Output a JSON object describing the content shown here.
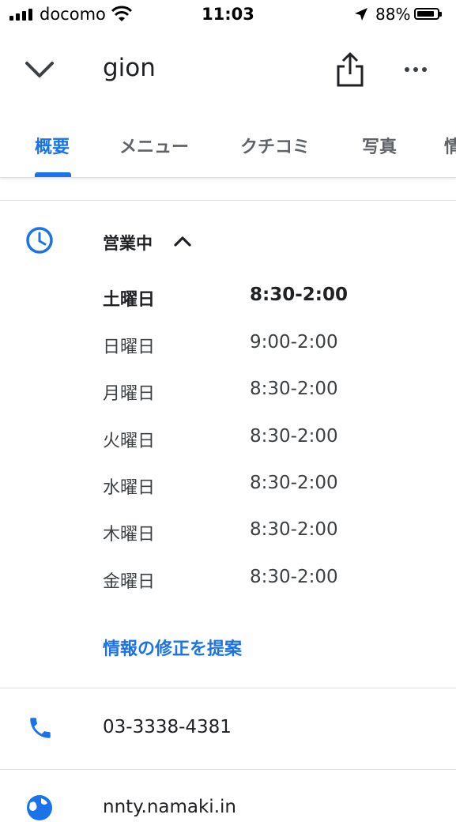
{
  "status_bar": {
    "carrier": "docomo",
    "time": "11:03",
    "battery_percent": "88%",
    "battery_level": 0.88,
    "icons": [
      "signal-icon",
      "wifi-icon",
      "location-arrow-icon",
      "battery-icon"
    ]
  },
  "header": {
    "title": "gion",
    "icons": [
      "chevron-down-icon",
      "share-icon",
      "more-icon"
    ]
  },
  "tabs": [
    {
      "label": "概要",
      "active": true
    },
    {
      "label": "メニュー",
      "active": false
    },
    {
      "label": "クチコミ",
      "active": false
    },
    {
      "label": "写真",
      "active": false
    },
    {
      "label": "情",
      "active": false
    }
  ],
  "hours": {
    "status": "営業中",
    "rows": [
      {
        "day": "土曜日",
        "hours": "8:30-2:00",
        "current": true
      },
      {
        "day": "日曜日",
        "hours": "9:00-2:00",
        "current": false
      },
      {
        "day": "月曜日",
        "hours": "8:30-2:00",
        "current": false
      },
      {
        "day": "火曜日",
        "hours": "8:30-2:00",
        "current": false
      },
      {
        "day": "水曜日",
        "hours": "8:30-2:00",
        "current": false
      },
      {
        "day": "木曜日",
        "hours": "8:30-2:00",
        "current": false
      },
      {
        "day": "金曜日",
        "hours": "8:30-2:00",
        "current": false
      }
    ],
    "suggest_edit": "情報の修正を提案"
  },
  "phone": {
    "number": "03-3338-4381"
  },
  "website": {
    "text": "nnty.namaki.in"
  },
  "colors": {
    "accent": "#1a73e8",
    "text": "#202124",
    "muted": "#5f6368"
  }
}
